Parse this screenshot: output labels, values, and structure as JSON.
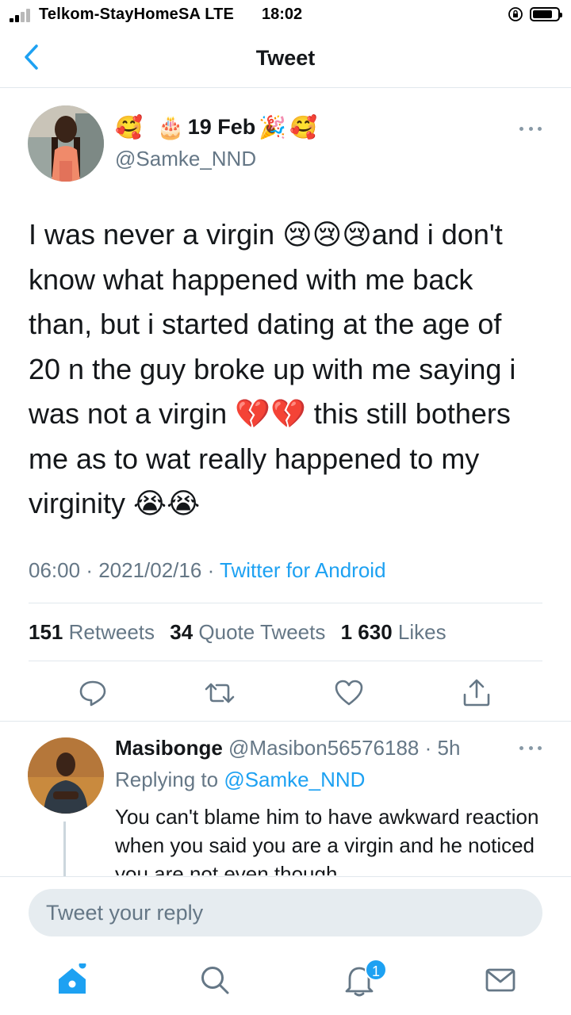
{
  "status_bar": {
    "carrier": "Telkom-StayHomeSA  LTE",
    "time": "18:02"
  },
  "header": {
    "title": "Tweet",
    "back_icon": "chevron-left-icon"
  },
  "tweet": {
    "display_name": {
      "emoji_left": "🥰",
      "emoji_cake": "🎂",
      "text": "19 Feb",
      "emoji_party": "🎉",
      "emoji_right": "🥰"
    },
    "handle": "@Samke_NND",
    "text_lines": [
      "I was never a virgin 😢😢😢and i don't",
      "know what happened with me back",
      "than, but i started dating at the age of",
      "20 n the guy broke up with me saying i",
      "was not a virgin 💔💔 this still bothers",
      "me as to wat really happened to my",
      "virginity 😭😭"
    ],
    "time": "06:00",
    "date": "2021/02/16",
    "source": "Twitter for Android",
    "stats": {
      "retweets_count": "151",
      "retweets_label": "Retweets",
      "quotes_count": "34",
      "quotes_label": "Quote Tweets",
      "likes_count": "1 630",
      "likes_label": "Likes"
    }
  },
  "reply": {
    "name": "Masibonge",
    "handle": "@Masibon56576188",
    "time": "5h",
    "replying_prefix": "Replying to",
    "replying_to": "@Samke_NND",
    "text": "You can't blame him to have awkward reaction when you said you are a virgin and he noticed you are not even though"
  },
  "composer": {
    "placeholder": "Tweet your reply"
  },
  "tabbar": {
    "notifications_badge": "1"
  },
  "colors": {
    "accent": "#1da1f2",
    "secondary_text": "#657786",
    "divider": "#e1e8ed"
  }
}
